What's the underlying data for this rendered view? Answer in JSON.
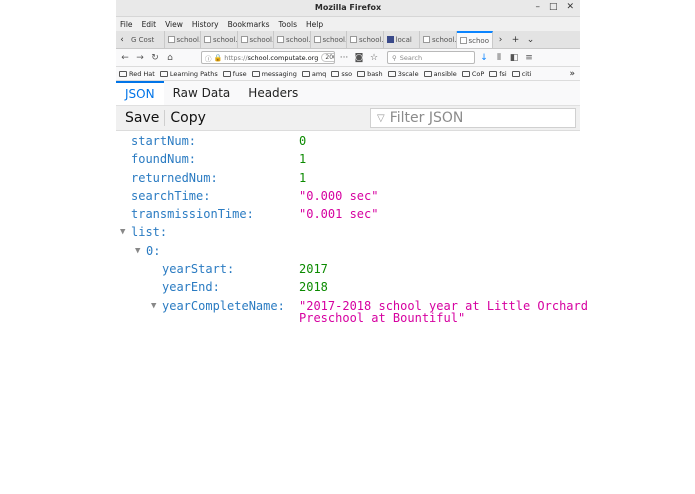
{
  "window": {
    "title": "Mozilla Firefox"
  },
  "menu": [
    "File",
    "Edit",
    "View",
    "History",
    "Bookmarks",
    "Tools",
    "Help"
  ],
  "tabs": [
    {
      "label": "G Cost",
      "favicon": "google"
    },
    {
      "label": "school.c",
      "favicon": "page"
    },
    {
      "label": "school.c",
      "favicon": "page"
    },
    {
      "label": "school.c",
      "favicon": "page"
    },
    {
      "label": "school.c",
      "favicon": "page"
    },
    {
      "label": "school.c",
      "favicon": "page"
    },
    {
      "label": "school.c",
      "favicon": "page"
    },
    {
      "label": "local",
      "favicon": "dark"
    },
    {
      "label": "school.c",
      "favicon": "page"
    },
    {
      "label": "schoo",
      "favicon": "page",
      "active": true
    }
  ],
  "nav": {
    "url_prefix": "https://",
    "url_domain": "school.computate.org",
    "zoom": "200%",
    "search_placeholder": "Search"
  },
  "bookmarks": [
    "Red Hat",
    "Learning Paths",
    "fuse",
    "messaging",
    "amq",
    "sso",
    "bash",
    "3scale",
    "ansible",
    "CoP",
    "fsi",
    "citi"
  ],
  "viewer_tabs": [
    "JSON",
    "Raw Data",
    "Headers"
  ],
  "toolbar": {
    "save": "Save",
    "copy": "Copy",
    "filter_placeholder": "Filter JSON"
  },
  "json": [
    {
      "key": "startNum:",
      "value": "0",
      "type": "num",
      "indent": 0
    },
    {
      "key": "foundNum:",
      "value": "1",
      "type": "num",
      "indent": 0
    },
    {
      "key": "returnedNum:",
      "value": "1",
      "type": "num",
      "indent": 0
    },
    {
      "key": "searchTime:",
      "value": "\"0.000 sec\"",
      "type": "str",
      "indent": 0
    },
    {
      "key": "transmissionTime:",
      "value": "\"0.001 sec\"",
      "type": "str",
      "indent": 0
    },
    {
      "key": "list:",
      "value": "",
      "type": "obj",
      "indent": 0,
      "expanded": true
    },
    {
      "key": "0:",
      "value": "",
      "type": "obj",
      "indent": 1,
      "expanded": true
    },
    {
      "key": "yearStart:",
      "value": "2017",
      "type": "num",
      "indent": 2
    },
    {
      "key": "yearEnd:",
      "value": "2018",
      "type": "num",
      "indent": 2
    },
    {
      "key": "yearCompleteName:",
      "value": "\"2017-2018 school year at Little Orchard",
      "value2": "Preschool at Bountiful\"",
      "type": "str",
      "indent": 2,
      "expanded": true
    }
  ]
}
